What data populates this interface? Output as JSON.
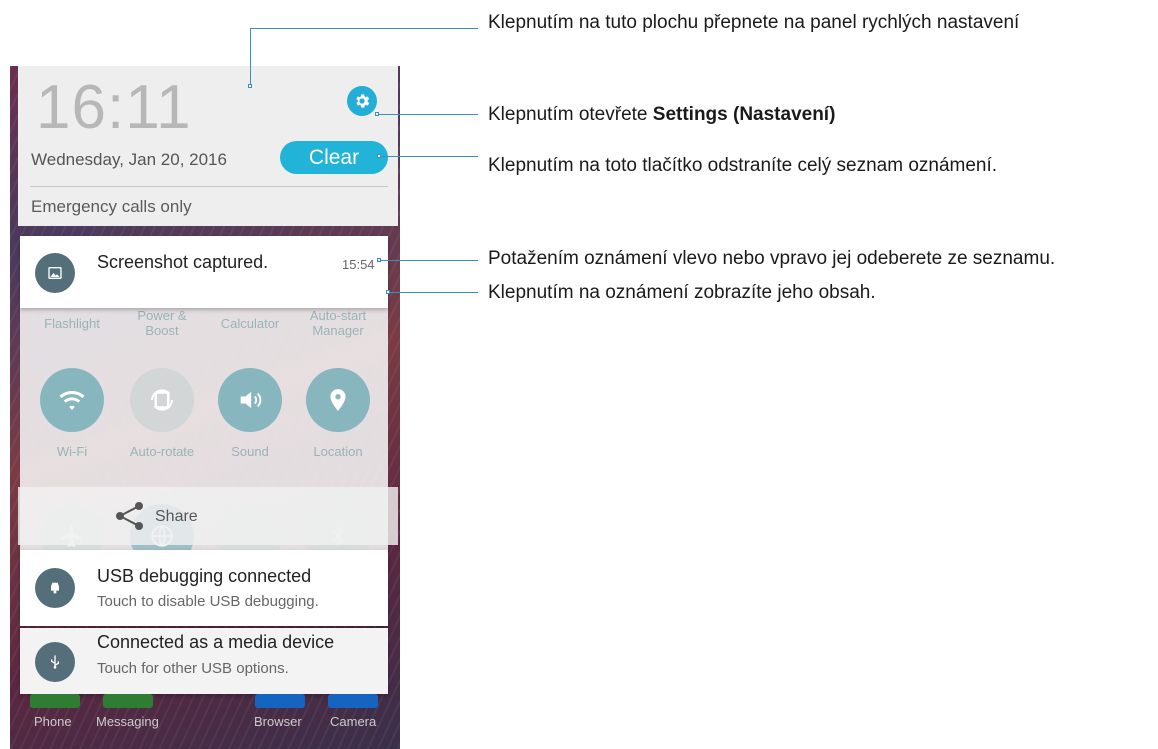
{
  "header": {
    "time": "16:11",
    "date": "Wednesday, Jan 20, 2016",
    "clear_label": "Clear",
    "network_status": "Emergency calls only"
  },
  "quick_settings": {
    "row1": [
      "Flashlight",
      "Power & Boost",
      "Calculator",
      "Auto-start Manager"
    ],
    "row2": [
      {
        "label": "Wi-Fi",
        "icon": "wifi-icon",
        "state": "on"
      },
      {
        "label": "Auto-rotate",
        "icon": "auto-rotate-icon",
        "state": "off"
      },
      {
        "label": "Sound",
        "icon": "sound-icon",
        "state": "on"
      },
      {
        "label": "Location",
        "icon": "location-icon",
        "state": "on"
      }
    ]
  },
  "share": {
    "label": "Share"
  },
  "notifications": [
    {
      "title": "Screenshot captured.",
      "time": "15:54",
      "icon": "image-icon"
    },
    {
      "title": "USB debugging connected",
      "subtitle": "Touch to disable USB debugging.",
      "icon": "android-icon"
    },
    {
      "title": "Connected as a media device",
      "subtitle": "Touch for other USB options.",
      "icon": "usb-icon"
    }
  ],
  "dock": [
    "Phone",
    "Messaging",
    "Browser",
    "Camera"
  ],
  "callouts": {
    "c1": "Klepnutím na tuto plochu přepnete na panel rychlých nastavení",
    "c2_prefix": "Klepnutím otevřete ",
    "c2_bold": "Settings (Nastavení)",
    "c3": "Klepnutím na toto tlačítko odstraníte celý seznam oznámení.",
    "c4": "Potažením oznámení vlevo nebo vpravo jej odeberete ze seznamu.",
    "c5": "Klepnutím na oznámení zobrazíte jeho obsah."
  },
  "colors": {
    "accent": "#22b3d9",
    "callout_line": "#3d8fc2",
    "notification_icon_bg": "#546e7a"
  }
}
